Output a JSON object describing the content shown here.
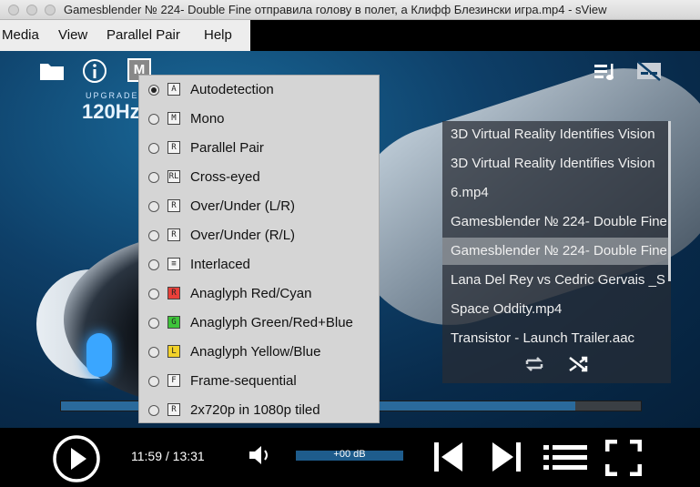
{
  "window": {
    "title": "Gamesblender № 224- Double Fine отправила голову в полет, а Клифф Блезински игра.mp4 - sView"
  },
  "menubar": {
    "items": [
      "Media",
      "View",
      "Parallel Pair",
      "Help"
    ]
  },
  "video": {
    "overlay_upgraded": "UPGRADED",
    "overlay_hz": "120Hz"
  },
  "toolbar": {
    "icons": [
      "folder-icon",
      "info-icon",
      "stereo-mode-icon",
      "playlist-icon",
      "subtitles-off-icon"
    ],
    "stereo_button_glyph": "M"
  },
  "stereo_menu": {
    "selected_index": 0,
    "items": [
      {
        "label": "Autodetection",
        "glyph": "A",
        "color": "#f4f4f4"
      },
      {
        "label": "Mono",
        "glyph": "M",
        "color": "#f4f4f4"
      },
      {
        "label": "Parallel Pair",
        "glyph": "R",
        "color": "#f4f4f4"
      },
      {
        "label": "Cross-eyed",
        "glyph": "RL",
        "color": "#f4f4f4"
      },
      {
        "label": "Over/Under (L/R)",
        "glyph": "R",
        "color": "#f4f4f4"
      },
      {
        "label": "Over/Under (R/L)",
        "glyph": "R",
        "color": "#f4f4f4"
      },
      {
        "label": "Interlaced",
        "glyph": "≡",
        "color": "#f4f4f4"
      },
      {
        "label": "Anaglyph Red/Cyan",
        "glyph": "R",
        "color": "#e8403a"
      },
      {
        "label": "Anaglyph Green/Red+Blue",
        "glyph": "G",
        "color": "#3ec43a"
      },
      {
        "label": "Anaglyph Yellow/Blue",
        "glyph": "L",
        "color": "#f2d22a"
      },
      {
        "label": "Frame-sequential",
        "glyph": "F",
        "color": "#f4f4f4"
      },
      {
        "label": "2x720p in 1080p tiled",
        "glyph": "R",
        "color": "#f4f4f4"
      }
    ]
  },
  "playlist": {
    "active_index": 4,
    "items": [
      "3D Virtual Reality Identifies Vision",
      "3D Virtual Reality Identifies Vision",
      "6.mp4",
      "Gamesblender № 224- Double Fine",
      "Gamesblender № 224- Double Fine",
      "Lana Del Rey vs Cedric Gervais _S",
      "Space Oddity.mp4",
      "Transistor - Launch Trailer.aac"
    ]
  },
  "playback": {
    "position": "11:59",
    "duration": "13:31",
    "time_text": "11:59 / 13:31",
    "progress": 0.887,
    "volume_label": "+00 dB"
  },
  "colors": {
    "accent": "#2a6a9c",
    "menu_bg": "#d5d5d5"
  }
}
